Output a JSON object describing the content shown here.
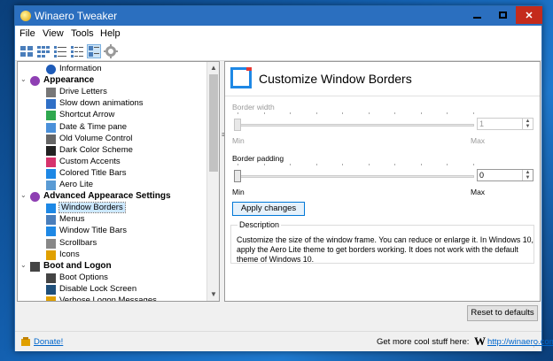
{
  "window": {
    "title": "Winaero Tweaker"
  },
  "menu": [
    "File",
    "View",
    "Tools",
    "Help"
  ],
  "toolbar": {
    "icons": [
      "large-icons",
      "small-icons",
      "list-view",
      "details-view",
      "tiles-view",
      "settings"
    ],
    "selected": "tiles-view"
  },
  "tree": {
    "rows": [
      {
        "label": "Information",
        "icon": "info-icon",
        "cat": false
      },
      {
        "label": "Appearance",
        "icon": "palette-icon",
        "cat": true
      },
      {
        "label": "Drive Letters",
        "icon": "drive-icon",
        "cat": false
      },
      {
        "label": "Slow down animations",
        "icon": "animation-icon",
        "cat": false
      },
      {
        "label": "Shortcut Arrow",
        "icon": "shortcut-arrow-icon",
        "cat": false
      },
      {
        "label": "Date & Time pane",
        "icon": "clock-icon",
        "cat": false
      },
      {
        "label": "Old Volume Control",
        "icon": "volume-icon",
        "cat": false
      },
      {
        "label": "Dark Color Scheme",
        "icon": "dark-scheme-icon",
        "cat": false
      },
      {
        "label": "Custom Accents",
        "icon": "accents-icon",
        "cat": false
      },
      {
        "label": "Colored Title Bars",
        "icon": "titlebar-icon",
        "cat": false
      },
      {
        "label": "Aero Lite",
        "icon": "aero-lite-icon",
        "cat": false
      },
      {
        "label": "Advanced Appearace Settings",
        "icon": "palette-icon",
        "cat": true
      },
      {
        "label": "Window Borders",
        "icon": "window-border-icon",
        "cat": false
      },
      {
        "label": "Menus",
        "icon": "menu-icon",
        "cat": false
      },
      {
        "label": "Window Title Bars",
        "icon": "titlebar-icon",
        "cat": false
      },
      {
        "label": "Scrollbars",
        "icon": "scrollbar-icon",
        "cat": false
      },
      {
        "label": "Icons",
        "icon": "icons-icon",
        "cat": false
      },
      {
        "label": "Boot and Logon",
        "icon": "boot-icon",
        "cat": true
      },
      {
        "label": "Boot Options",
        "icon": "boot-icon",
        "cat": false
      },
      {
        "label": "Disable Lock Screen",
        "icon": "lock-screen-icon",
        "cat": false
      },
      {
        "label": "Verbose Logon Messages",
        "icon": "message-icon",
        "cat": false
      }
    ],
    "selected": "Window Borders"
  },
  "panel": {
    "title": "Customize Window Borders",
    "border_width": {
      "label": "Border width",
      "min": "Min",
      "max": "Max",
      "value": "1",
      "level": 0,
      "enabled": false
    },
    "border_padding": {
      "label": "Border padding",
      "min": "Min",
      "max": "Max",
      "value": "0",
      "level": 0,
      "enabled": true
    },
    "apply_label": "Apply changes",
    "description_title": "Description",
    "description": "Customize the size of the window frame. You can reduce or enlarge it. In Windows 10, apply the Aero Lite theme to get borders working. It does not work with the default theme of Windows 10."
  },
  "reset_label": "Reset to defaults",
  "status": {
    "donate": "Donate!",
    "promo": "Get more cool stuff here:",
    "w_logo": "W",
    "url": "http://winaero.com"
  },
  "colors": {
    "titlebar": "#2b6fbf",
    "close": "#c42b1c",
    "selection": "#cce8ff",
    "accent": "#1e88e5"
  }
}
